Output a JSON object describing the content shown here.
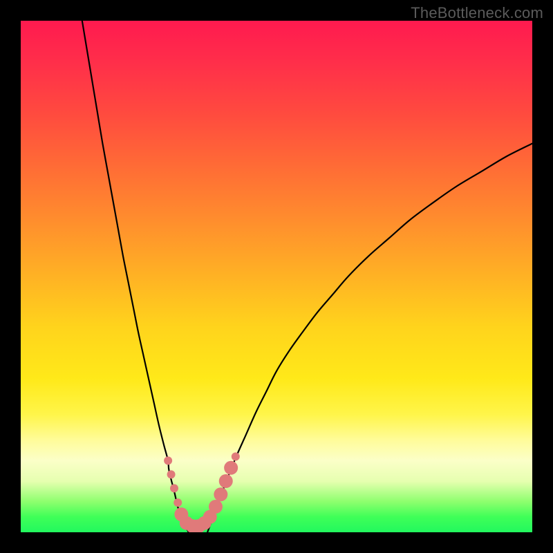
{
  "watermark": "TheBottleneck.com",
  "chart_data": {
    "type": "line",
    "title": "",
    "xlabel": "",
    "ylabel": "",
    "xlim": [
      0,
      100
    ],
    "ylim": [
      0,
      100
    ],
    "gradient_stops": [
      {
        "pos": 0,
        "color": "#ff1a4f"
      },
      {
        "pos": 30,
        "color": "#ff7030"
      },
      {
        "pos": 60,
        "color": "#ffd41c"
      },
      {
        "pos": 82,
        "color": "#fffc9a"
      },
      {
        "pos": 92,
        "color": "#baff8c"
      },
      {
        "pos": 100,
        "color": "#22f85e"
      }
    ],
    "series": [
      {
        "name": "left_branch",
        "x": [
          12.0,
          13.0,
          14.0,
          15.0,
          16.0,
          17.0,
          18.0,
          19.0,
          20.0,
          21.0,
          22.0,
          23.0,
          24.0,
          25.0,
          26.0,
          27.0,
          28.0,
          28.8,
          29.0,
          30.0,
          31.0,
          32.8
        ],
        "y": [
          100.0,
          94.0,
          88.0,
          82.0,
          76.0,
          70.5,
          65.0,
          59.5,
          54.0,
          49.0,
          44.0,
          39.0,
          34.5,
          30.0,
          25.5,
          21.0,
          17.0,
          14.0,
          12.0,
          8.0,
          4.0,
          0.0
        ]
      },
      {
        "name": "right_branch",
        "x": [
          36.5,
          38.0,
          40.0,
          42.0,
          44.0,
          46.0,
          48.0,
          50.0,
          52.5,
          55.0,
          58.0,
          61.0,
          64.0,
          68.0,
          72.0,
          76.0,
          80.0,
          85.0,
          90.0,
          95.0,
          100.0
        ],
        "y": [
          0.0,
          4.0,
          9.5,
          14.5,
          19.0,
          23.5,
          27.5,
          31.5,
          35.5,
          39.0,
          43.0,
          46.5,
          50.0,
          54.0,
          57.5,
          61.0,
          64.0,
          67.5,
          70.5,
          73.5,
          76.0
        ]
      }
    ],
    "markers": {
      "name": "pink_dots",
      "color": "#e07a7a",
      "radius_small": 6,
      "radius_large": 10,
      "points": [
        {
          "x": 28.8,
          "y": 14.0,
          "r": "small"
        },
        {
          "x": 29.4,
          "y": 11.3,
          "r": "small"
        },
        {
          "x": 30.0,
          "y": 8.6,
          "r": "small"
        },
        {
          "x": 30.7,
          "y": 5.8,
          "r": "small"
        },
        {
          "x": 31.4,
          "y": 3.5,
          "r": "large"
        },
        {
          "x": 32.4,
          "y": 1.8,
          "r": "large"
        },
        {
          "x": 33.6,
          "y": 1.2,
          "r": "large"
        },
        {
          "x": 34.8,
          "y": 1.2,
          "r": "large"
        },
        {
          "x": 35.9,
          "y": 1.8,
          "r": "large"
        },
        {
          "x": 37.0,
          "y": 3.0,
          "r": "large"
        },
        {
          "x": 38.1,
          "y": 5.0,
          "r": "large"
        },
        {
          "x": 39.1,
          "y": 7.4,
          "r": "large"
        },
        {
          "x": 40.1,
          "y": 10.0,
          "r": "large"
        },
        {
          "x": 41.1,
          "y": 12.6,
          "r": "large"
        },
        {
          "x": 42.0,
          "y": 14.8,
          "r": "small"
        }
      ]
    }
  }
}
